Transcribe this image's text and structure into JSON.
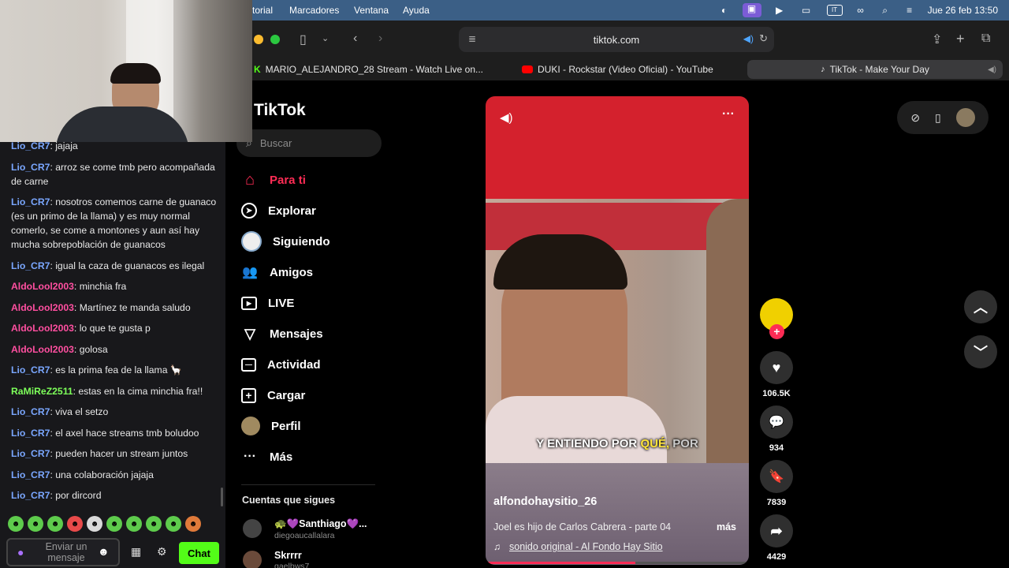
{
  "menubar": {
    "items": [
      "torial",
      "Marcadores",
      "Ventana",
      "Ayuda"
    ],
    "clock": "Jue 26 feb  13:50",
    "keyboard": "IT"
  },
  "browser": {
    "url": "tiktok.com",
    "tabs": [
      {
        "label": "MARIO_ALEJANDRO_28 Stream - Watch Live on..."
      },
      {
        "label": "DUKI - Rockstar (Video Oficial) - YouTube"
      },
      {
        "label": "TikTok - Make Your Day"
      }
    ]
  },
  "chat": {
    "messages": [
      {
        "user": "Lio_CR7",
        "text": "jajaja",
        "color": "#7aa7ff"
      },
      {
        "user": "Lio_CR7",
        "text": "arroz se come tmb pero acompañada de carne",
        "color": "#7aa7ff"
      },
      {
        "user": "Lio_CR7",
        "text": "nosotros comemos carne de guanaco (es un primo de la llama) y es muy normal comerlo, se come a montones y aun así hay mucha sobrepoblación de guanacos",
        "color": "#7aa7ff"
      },
      {
        "user": "Lio_CR7",
        "text": "igual la caza de guanacos es ilegal",
        "color": "#7aa7ff"
      },
      {
        "user": "AldoLool2003",
        "text": "minchia fra",
        "color": "#ff4fa0"
      },
      {
        "user": "AldoLool2003",
        "text": "Martínez te manda saludo",
        "color": "#ff4fa0"
      },
      {
        "user": "AldoLool2003",
        "text": "lo que te gusta p",
        "color": "#ff4fa0"
      },
      {
        "user": "AldoLool2003",
        "text": "golosa",
        "color": "#ff4fa0"
      },
      {
        "user": "Lio_CR7",
        "text": "es la prima fea de la llama 🦙",
        "color": "#7aa7ff"
      },
      {
        "user": "RaMiReZ2511",
        "text": "estas en la cima minchia fra!!",
        "color": "#7dff5a"
      },
      {
        "user": "Lio_CR7",
        "text": "viva el setzo",
        "color": "#7aa7ff"
      },
      {
        "user": "Lio_CR7",
        "text": "el axel hace streams tmb boludoo",
        "color": "#7aa7ff"
      },
      {
        "user": "Lio_CR7",
        "text": "pueden hacer un stream juntos",
        "color": "#7aa7ff"
      },
      {
        "user": "Lio_CR7",
        "text": "una colaboración jajaja",
        "color": "#7aa7ff"
      },
      {
        "user": "Lio_CR7",
        "text": "por dircord",
        "color": "#7aa7ff"
      }
    ],
    "input_placeholder": "Enviar un mensaje",
    "send_label": "Chat"
  },
  "tiktok": {
    "logo": "TikTok",
    "search_placeholder": "Buscar",
    "nav": [
      "Para ti",
      "Explorar",
      "Siguiendo",
      "Amigos",
      "LIVE",
      "Mensajes",
      "Actividad",
      "Cargar",
      "Perfil",
      "Más"
    ],
    "following_title": "Cuentas que sigues",
    "following": [
      {
        "name": "🐢💜Santhiago💜...",
        "handle": "diegoaucallalara"
      },
      {
        "name": "Skrrrr",
        "handle": "gaelbws7"
      }
    ],
    "video": {
      "subtitle_a": "Y ENTIENDO POR ",
      "subtitle_b": "QUÉ,",
      "subtitle_c": " POR",
      "author": "alfondohaysitio_26",
      "description": "Joel es hijo de Carlos Cabrera - parte 04",
      "more": "más",
      "sound": "sonido original - Al Fondo Hay Sitio"
    },
    "actions": {
      "likes": "106.5K",
      "comments": "934",
      "saves": "7839",
      "shares": "4429"
    }
  }
}
